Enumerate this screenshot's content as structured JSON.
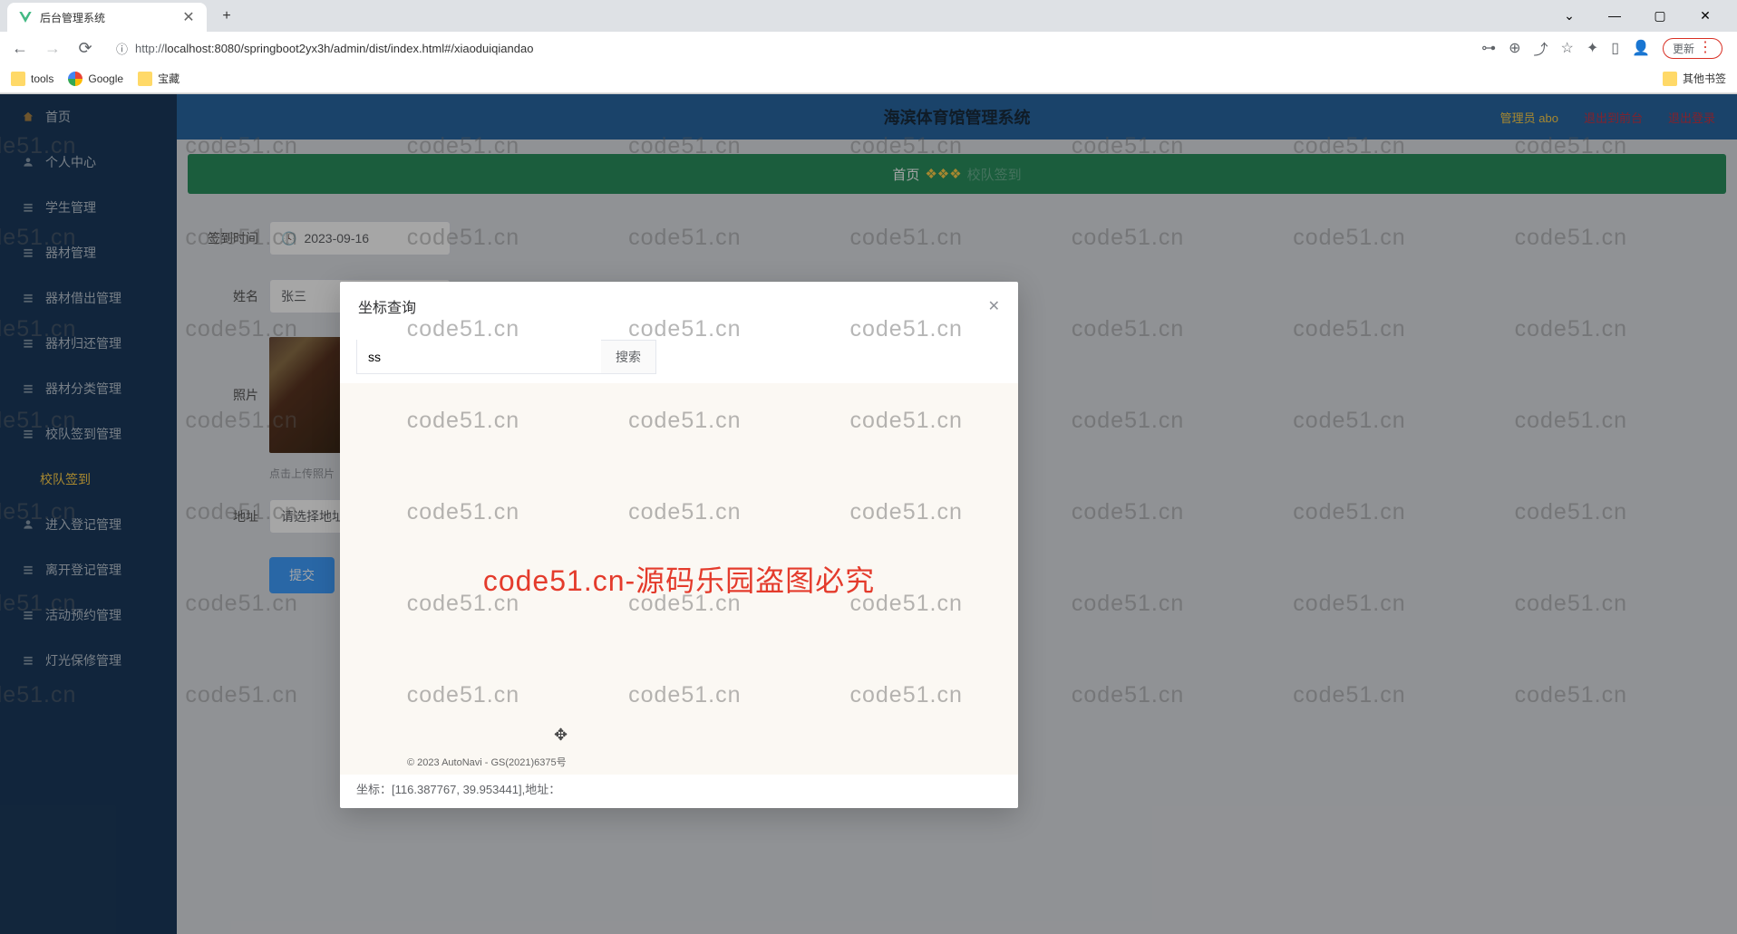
{
  "browser": {
    "tab_title": "后台管理系统",
    "url_prefix": "http://",
    "url": "localhost:8080/springboot2yx3h/admin/dist/index.html#/xiaoduiqiandao",
    "update_label": "更新",
    "bookmarks": {
      "tools": "tools",
      "google": "Google",
      "treasure": "宝藏",
      "other": "其他书签"
    }
  },
  "sidebar": {
    "items": [
      {
        "label": "首页"
      },
      {
        "label": "个人中心"
      },
      {
        "label": "学生管理"
      },
      {
        "label": "器材管理"
      },
      {
        "label": "器材借出管理"
      },
      {
        "label": "器材归还管理"
      },
      {
        "label": "器材分类管理"
      },
      {
        "label": "校队签到管理"
      },
      {
        "label": "校队签到"
      },
      {
        "label": "进入登记管理"
      },
      {
        "label": "离开登记管理"
      },
      {
        "label": "活动预约管理"
      },
      {
        "label": "灯光保修管理"
      }
    ]
  },
  "header": {
    "title": "海滨体育馆管理系统",
    "admin": "管理员 abo",
    "link1": "退出到前台",
    "link2": "退出登录"
  },
  "banner": {
    "home": "首页",
    "sub": "校队签到"
  },
  "form": {
    "time_label": "签到时间",
    "time_value": "2023-09-16",
    "name_label": "姓名",
    "name_value": "张三",
    "photo_label": "照片",
    "upload_hint": "点击上传照片",
    "address_label": "地址",
    "address_placeholder": "请选择地址",
    "submit": "提交"
  },
  "dialog": {
    "title": "坐标查询",
    "search_value": "ss",
    "search_btn": "搜索",
    "map_watermark": "code51.cn-源码乐园盗图必究",
    "copyright": "© 2023 AutoNavi - GS(2021)6375号",
    "coord_label": "坐标：",
    "coord_value": "[116.387767, 39.953441],地址："
  },
  "watermark": "code51.cn"
}
